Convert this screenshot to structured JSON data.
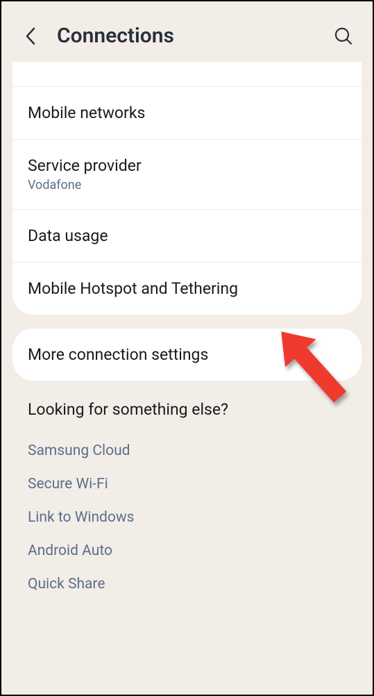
{
  "header": {
    "title": "Connections"
  },
  "list1": {
    "items": [
      {
        "title": "Mobile networks",
        "sub": ""
      },
      {
        "title": "Service provider",
        "sub": "Vodafone"
      },
      {
        "title": "Data usage",
        "sub": ""
      },
      {
        "title": "Mobile Hotspot and Tethering",
        "sub": ""
      }
    ]
  },
  "list2": {
    "items": [
      {
        "title": "More connection settings"
      }
    ]
  },
  "suggestions": {
    "heading": "Looking for something else?",
    "links": [
      "Samsung Cloud",
      "Secure Wi-Fi",
      "Link to Windows",
      "Android Auto",
      "Quick Share"
    ]
  }
}
